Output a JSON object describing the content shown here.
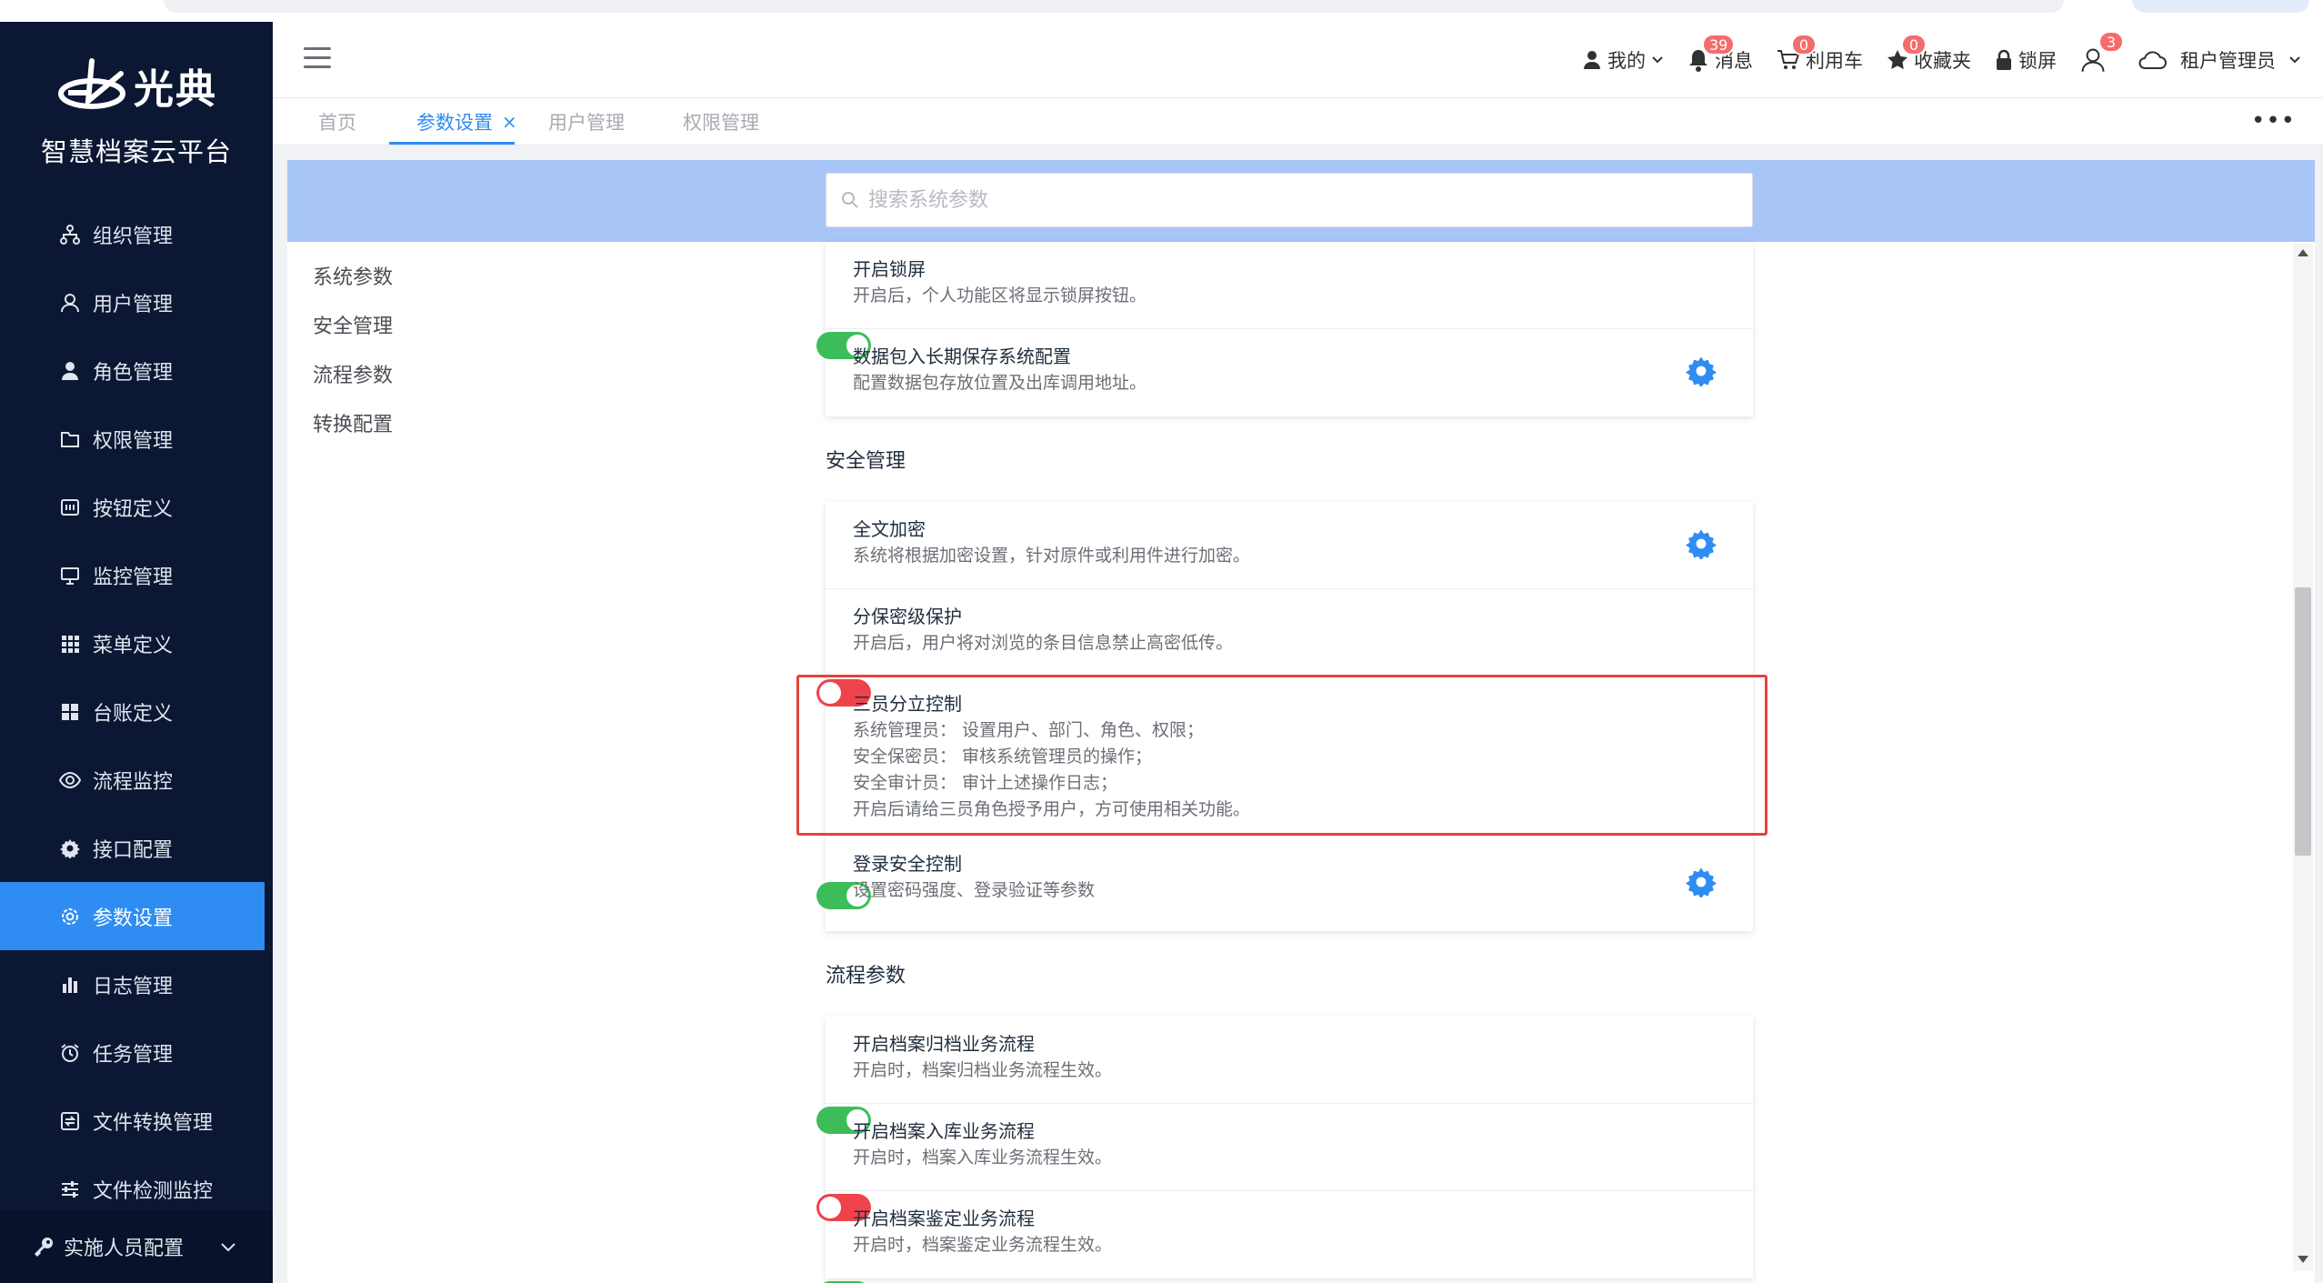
{
  "brand": {
    "logo_text": "光典",
    "platform_name": "智慧档案云平台"
  },
  "sidebar": {
    "items": [
      {
        "label": "组织管理",
        "icon": "org-tree-icon"
      },
      {
        "label": "用户管理",
        "icon": "user-outline-icon"
      },
      {
        "label": "角色管理",
        "icon": "user-solid-icon"
      },
      {
        "label": "权限管理",
        "icon": "folder-icon"
      },
      {
        "label": "按钮定义",
        "icon": "button-icon"
      },
      {
        "label": "监控管理",
        "icon": "monitor-icon"
      },
      {
        "label": "菜单定义",
        "icon": "grid-icon"
      },
      {
        "label": "台账定义",
        "icon": "tiles-icon"
      },
      {
        "label": "流程监控",
        "icon": "eye-icon"
      },
      {
        "label": "接口配置",
        "icon": "gear-icon"
      },
      {
        "label": "参数设置",
        "icon": "settings-icon"
      },
      {
        "label": "日志管理",
        "icon": "bar-chart-icon"
      },
      {
        "label": "任务管理",
        "icon": "alarm-clock-icon"
      },
      {
        "label": "文件转换管理",
        "icon": "file-convert-icon"
      },
      {
        "label": "文件检测监控",
        "icon": "sliders-icon"
      }
    ],
    "active_index": 10,
    "bottom_item": {
      "label": "实施人员配置",
      "icon": "key-icon"
    }
  },
  "header": {
    "mine_label": "我的",
    "messages": {
      "label": "消息",
      "count": "39"
    },
    "usage_cart": {
      "label": "利用车",
      "count": "0"
    },
    "favorites": {
      "label": "收藏夹",
      "count": "0"
    },
    "lock_label": "锁屏",
    "user_badge": "3",
    "tenant_label": "租户管理员"
  },
  "tabs": [
    {
      "label": "首页",
      "active": false
    },
    {
      "label": "参数设置",
      "active": true,
      "closable": true
    },
    {
      "label": "用户管理",
      "active": false
    },
    {
      "label": "权限管理",
      "active": false
    }
  ],
  "tabs_more_label": "•••",
  "search": {
    "placeholder": "搜索系统参数",
    "value": ""
  },
  "left_nav": [
    "系统参数",
    "安全管理",
    "流程参数",
    "转换配置"
  ],
  "colors": {
    "accent": "#2f8cf3",
    "switch_on": "#3dbd5a",
    "switch_off": "#f0424a",
    "highlight": "#e8413c",
    "sidebar_bg": "#0b1733"
  },
  "sections": {
    "system_tail": [
      {
        "title": "开启锁屏",
        "desc": [
          "开启后，个人功能区将显示锁屏按钮。"
        ],
        "control": "switch",
        "on": true
      },
      {
        "title": "数据包入长期保存系统配置",
        "desc": [
          "配置数据包存放位置及出库调用地址。"
        ],
        "control": "gear"
      }
    ],
    "security": {
      "title": "安全管理",
      "rows": [
        {
          "title": "全文加密",
          "desc": [
            "系统将根据加密设置，针对原件或利用件进行加密。"
          ],
          "control": "gear"
        },
        {
          "title": "分保密级保护",
          "desc": [
            "开启后，用户将对浏览的条目信息禁止高密低传。"
          ],
          "control": "switch",
          "on": false
        },
        {
          "title": "三员分立控制",
          "desc": [
            "系统管理员： 设置用户、部门、角色、权限；",
            "安全保密员： 审核系统管理员的操作；",
            "安全审计员： 审计上述操作日志；",
            "开启后请给三员角色授予用户，方可使用相关功能。"
          ],
          "control": "switch",
          "on": true,
          "highlighted": true
        },
        {
          "title": "登录安全控制",
          "desc": [
            "设置密码强度、登录验证等参数"
          ],
          "control": "gear"
        }
      ]
    },
    "workflow": {
      "title": "流程参数",
      "rows": [
        {
          "title": "开启档案归档业务流程",
          "desc": [
            "开启时，档案归档业务流程生效。"
          ],
          "control": "switch",
          "on": true
        },
        {
          "title": "开启档案入库业务流程",
          "desc": [
            "开启时，档案入库业务流程生效。"
          ],
          "control": "switch",
          "on": false
        },
        {
          "title": "开启档案鉴定业务流程",
          "desc": [
            "开启时，档案鉴定业务流程生效。"
          ],
          "control": "switch",
          "on": true
        }
      ]
    }
  }
}
